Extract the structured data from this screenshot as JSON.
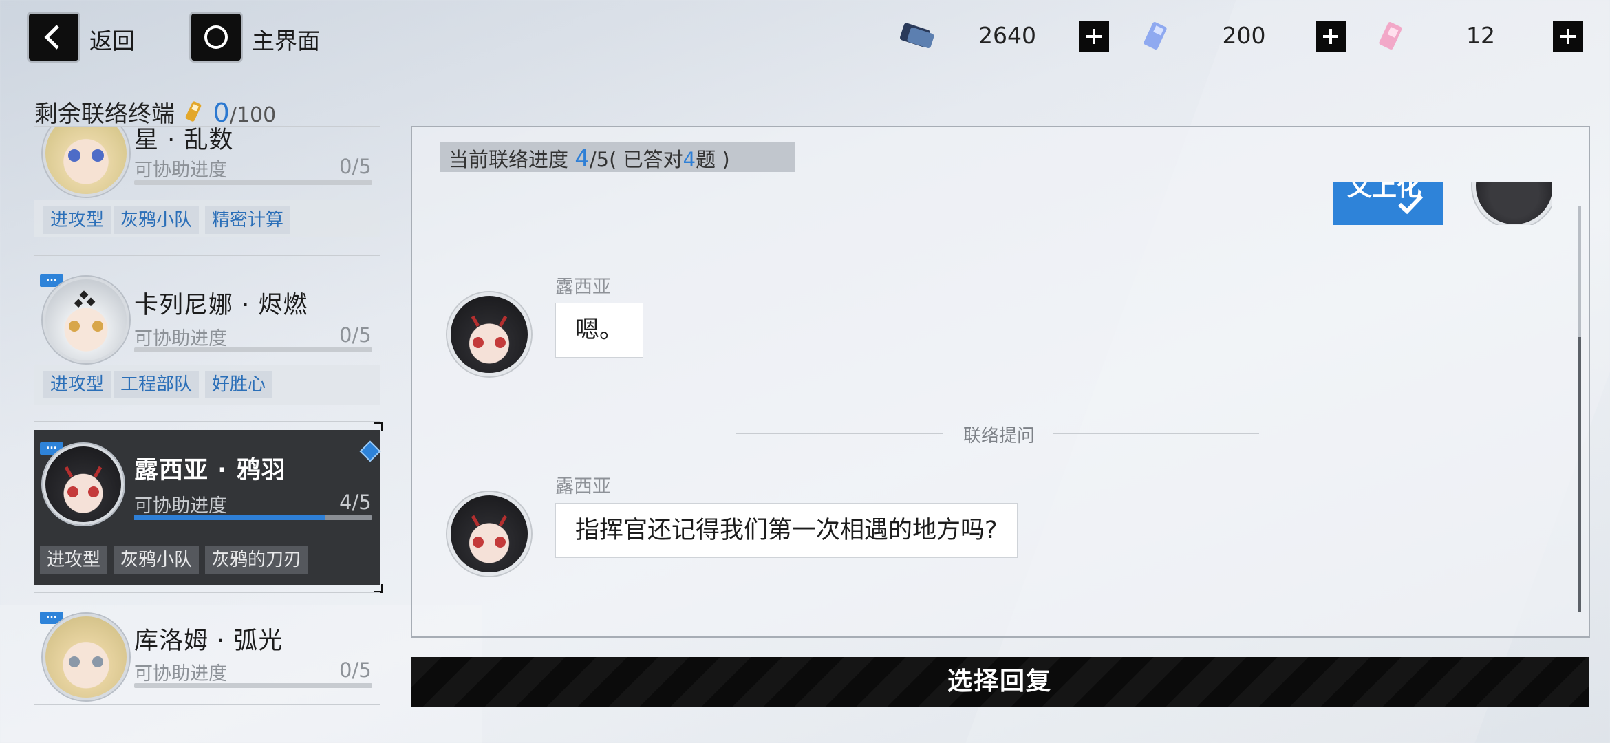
{
  "topbar": {
    "back_label": "返回",
    "home_label": "主界面",
    "resources": [
      {
        "icon": "black-card-icon",
        "value": "2640"
      },
      {
        "icon": "blue-ticket-icon",
        "value": "200"
      },
      {
        "icon": "pink-ticket-icon",
        "value": "12"
      }
    ]
  },
  "terminals": {
    "label": "剩余联络终端",
    "count": "0",
    "total": "/100"
  },
  "characters": [
    {
      "name": "星 · 乱数",
      "progress_label": "可协助进度",
      "progress": "0/5",
      "progress_fraction": 0,
      "tags": [
        "进攻型",
        "灰鸦小队",
        "精密计算"
      ]
    },
    {
      "name": "卡列尼娜 · 烬燃",
      "progress_label": "可协助进度",
      "progress": "0/5",
      "progress_fraction": 0,
      "tags": [
        "进攻型",
        "工程部队",
        "好胜心"
      ]
    },
    {
      "name": "露西亚 · 鸦羽",
      "progress_label": "可协助进度",
      "progress": "4/5",
      "progress_fraction": 0.8,
      "tags": [
        "进攻型",
        "灰鸦小队",
        "灰鸦的刀刃"
      ],
      "selected": true
    },
    {
      "name": "库洛姆 · 弧光",
      "progress_label": "可协助进度",
      "progress": "0/5",
      "progress_fraction": 0
    }
  ],
  "chat": {
    "progress_label": "当前联络进度",
    "progress_current": "4",
    "progress_total": "/5",
    "answered_prefix": "( 已答对",
    "answered_count": "4",
    "answered_suffix": "题 )",
    "messages": [
      {
        "sender": "露西亚",
        "text": "嗯。"
      },
      {
        "sender": "露西亚",
        "text": "指挥官还记得我们第一次相遇的地方吗?"
      }
    ],
    "system_label": "联络提问",
    "partial_text": "义上化"
  },
  "reply_button": "选择回复",
  "colors": {
    "accent": "#2e7fd6",
    "dark": "#0b0b0b",
    "selected_card": "#333538"
  }
}
